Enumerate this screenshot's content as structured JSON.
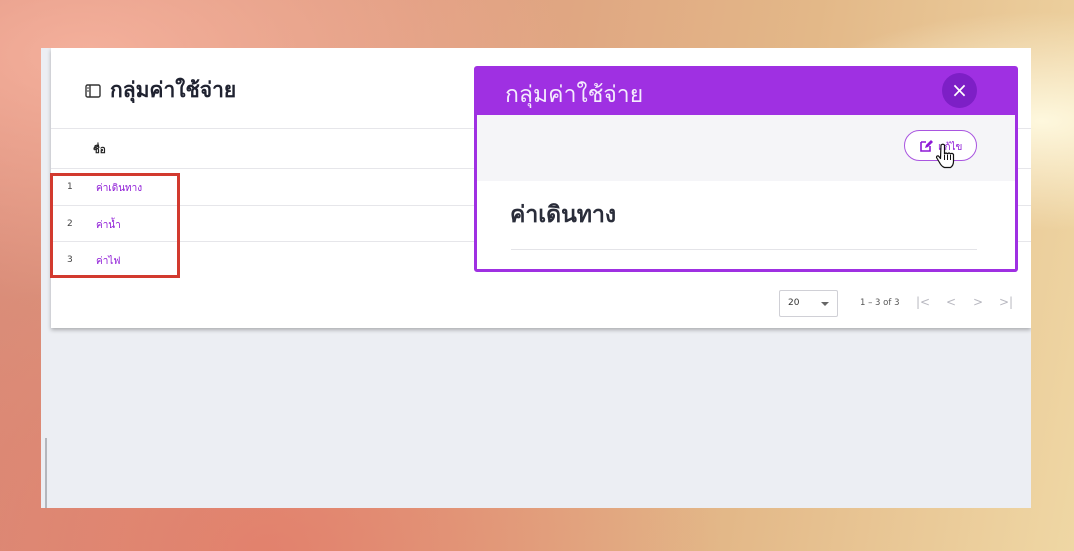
{
  "page": {
    "title": "กลุ่มค่าใช้จ่าย",
    "title_icon": "book-icon"
  },
  "table": {
    "column_header": "ชื่อ",
    "rows": [
      {
        "num": "1",
        "name": "ค่าเดินทาง"
      },
      {
        "num": "2",
        "name": "ค่าน้ำ"
      },
      {
        "num": "3",
        "name": "ค่าไฟ"
      }
    ]
  },
  "pagination": {
    "per_page": "20",
    "range_text": "1 – 3 of 3",
    "first_icon": "|<",
    "prev_icon": "<",
    "next_icon": ">",
    "last_icon": ">|"
  },
  "modal": {
    "title": "กลุ่มค่าใช้จ่าย",
    "close_icon": "×",
    "edit_label": "แก้ไข",
    "record_name": "ค่าเดินทาง"
  },
  "colors": {
    "accent": "#9f30e2",
    "link": "#8e1ad6",
    "highlight_box": "#d23a2f"
  }
}
